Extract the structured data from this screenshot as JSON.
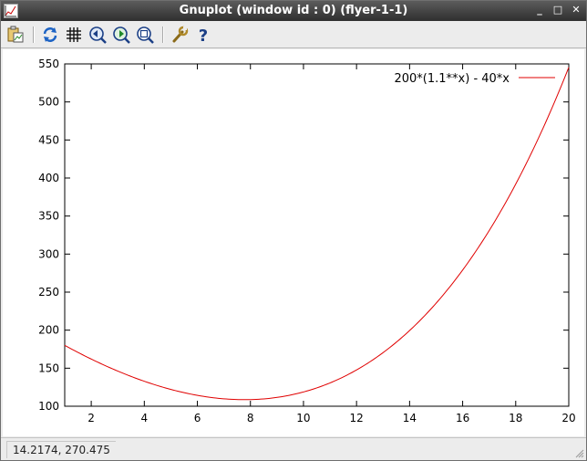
{
  "window": {
    "title": "Gnuplot (window id : 0) (flyer-1-1)",
    "controls": {
      "minimize": "_",
      "maximize": "□",
      "close": "✕"
    }
  },
  "toolbar": {
    "items": [
      {
        "name": "copy-to-clipboard",
        "icon": "clipboard-icon"
      },
      {
        "name": "replot",
        "icon": "refresh-icon"
      },
      {
        "name": "toggle-grid",
        "icon": "grid-icon"
      },
      {
        "name": "previous-zoom",
        "icon": "zoom-back-icon"
      },
      {
        "name": "next-zoom",
        "icon": "zoom-forward-icon"
      },
      {
        "name": "autoscale",
        "icon": "zoom-fit-icon"
      },
      {
        "name": "configuration",
        "icon": "wrench-icon"
      },
      {
        "name": "help",
        "icon": "help-icon"
      }
    ]
  },
  "status": {
    "coords": "14.2174,  270.475"
  },
  "colors": {
    "curve": "#e00000",
    "axis": "#000000"
  },
  "chart_data": {
    "type": "line",
    "function": "200*(1.1**x) - 40*x",
    "series": [
      {
        "name": "200*(1.1**x) - 40*x",
        "x_range": [
          1,
          20
        ]
      }
    ],
    "xlim": [
      1,
      20
    ],
    "ylim": [
      100,
      550
    ],
    "xticks": [
      "2",
      "4",
      "6",
      "8",
      "10",
      "12",
      "14",
      "16",
      "18",
      "20"
    ],
    "yticks": [
      "100",
      "150",
      "200",
      "250",
      "300",
      "350",
      "400",
      "450",
      "500",
      "550"
    ],
    "grid": false,
    "legend_position": "top-right"
  }
}
